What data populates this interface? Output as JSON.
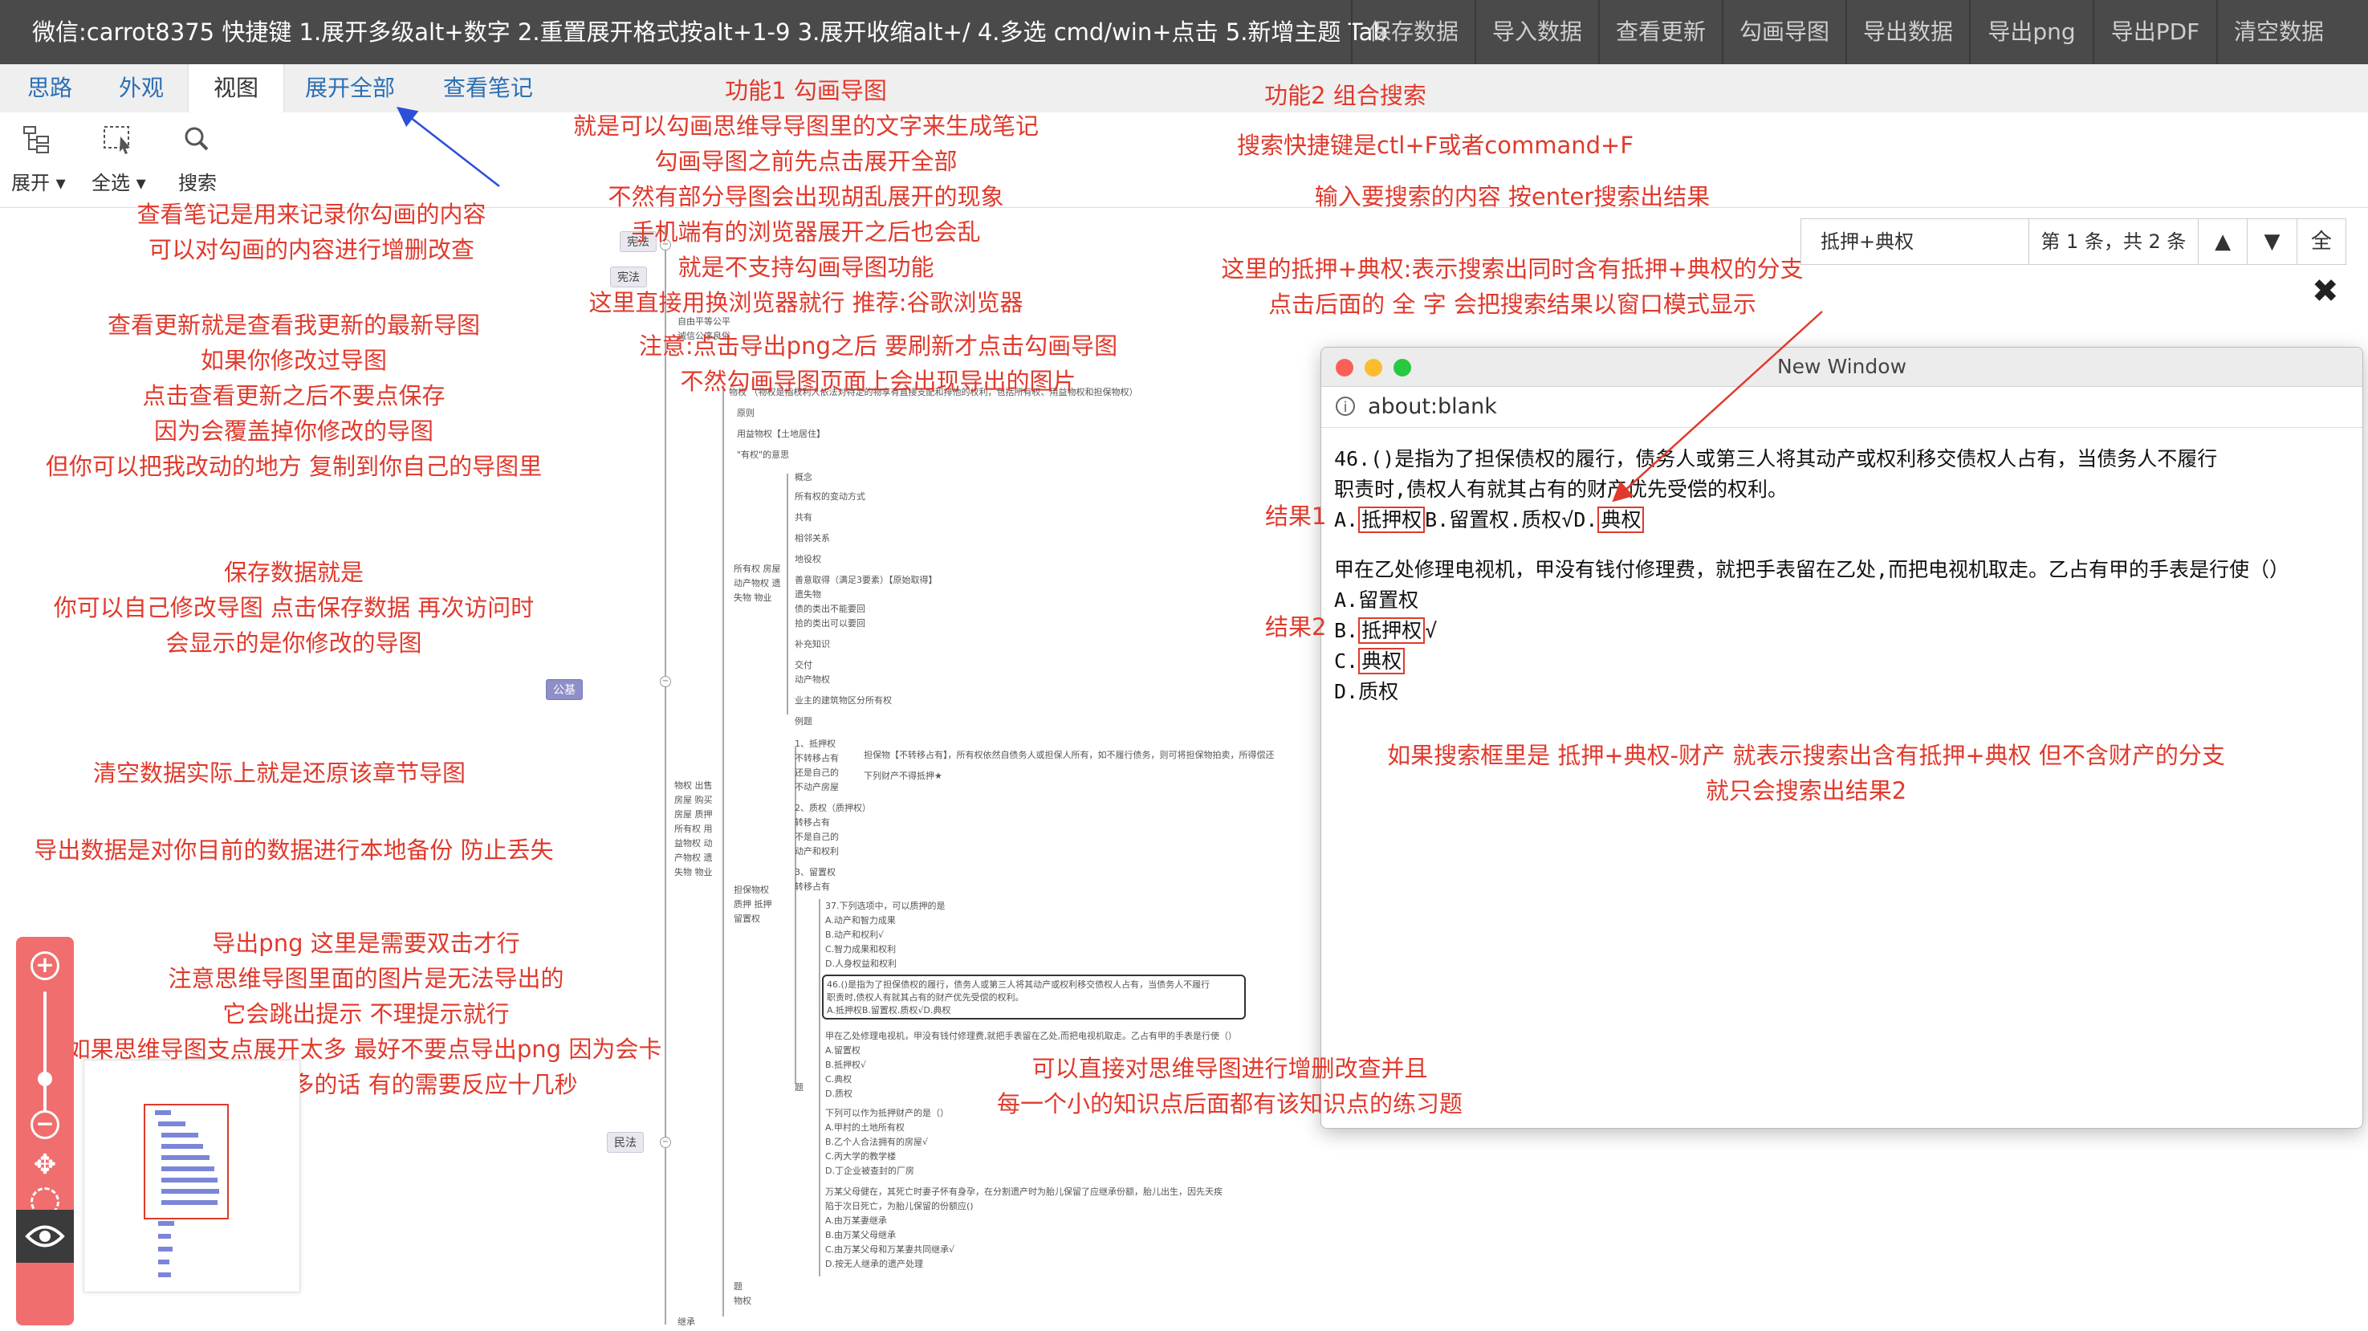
{
  "topbar": {
    "title": "微信:carrot8375 快捷键 1.展开多级alt+数字 2.重置展开格式按alt+1-9 3.展开收缩alt+/ 4.多选 cmd/win+点击 5.新增主题 Tab",
    "buttons": [
      "保存数据",
      "导入数据",
      "查看更新",
      "勾画导图",
      "导出数据",
      "导出png",
      "导出PDF",
      "清空数据"
    ]
  },
  "tabs": [
    "思路",
    "外观",
    "视图",
    "展开全部",
    "查看笔记"
  ],
  "toolbar": {
    "expand": "展开",
    "select_all": "全选",
    "search": "搜索"
  },
  "annotations": {
    "left": [
      "查看笔记是用来记录你勾画的内容",
      "可以对勾画的内容进行增删改查",
      "查看更新就是查看我更新的最新导图",
      "如果你修改过导图",
      "点击查看更新之后不要点保存",
      "因为会覆盖掉你修改的导图",
      "但你可以把我改动的地方 复制到你自己的导图里",
      "保存数据就是",
      "你可以自己修改导图 点击保存数据 再次访问时",
      "会显示的是你修改的导图",
      "清空数据实际上就是还原该章节导图",
      "导出数据是对你目前的数据进行本地备份 防止丢失",
      "导出png 这里是需要双击才行",
      "注意思维导图里面的图片是无法导出的",
      "它会跳出提示 不理提示就行",
      "如果思维导图支点展开太多 最好不要点导出png 因为会卡",
      "如果展开内容多的话 有的需要反应十几秒"
    ],
    "func1": [
      "功能1 勾画导图",
      "就是可以勾画思维导导图里的文字来生成笔记",
      "勾画导图之前先点击展开全部",
      "不然有部分导图会出现胡乱展开的现象",
      "手机端有的浏览器展开之后也会乱",
      "就是不支持勾画导图功能",
      "这里直接用换浏览器就行 推荐:谷歌浏览器",
      "注意:点击导出png之后 要刷新才点击勾画导图",
      "不然勾画导图页面上会出现导出的图片"
    ],
    "func2": [
      "功能2 组合搜索",
      "搜索快捷键是ctl+F或者command+F",
      "输入要搜索的内容 按enter搜索出结果",
      "这里的抵押+典权:表示搜索出同时含有抵押+典权的分支",
      "点击后面的 全 字 会把搜索结果以窗口模式显示"
    ],
    "result1": "结果1",
    "result2": "结果2",
    "exclude": [
      "如果搜索框里是 抵押+典权-财产  就表示搜索出含有抵押+典权 但不含财产的分支",
      "就只会搜索出结果2"
    ],
    "bottom": [
      "可以直接对思维导图进行增删改查并且",
      "每一个小的知识点后面都有该知识点的练习题"
    ]
  },
  "search": {
    "value": "抵押+典权",
    "count": "第 1 条，共 2 条",
    "up": "▲",
    "down": "▼",
    "all": "全"
  },
  "popup": {
    "title": "New Window",
    "url": "about:blank",
    "q1_line1": "46.()是指为了担保债权的履行，债务人或第三人将其动产或权利移交债权人占有，当债务人不履行",
    "q1_line2": "职责时,债权人有就其占有的财产优先受偿的权利。",
    "q1_prefix": "A.",
    "q1_opt_a": "抵押权",
    "q1_mid": "B.留置权.质权√D.",
    "q1_opt_d": "典权",
    "q2_stem": "甲在乙处修理电视机，甲没有钱付修理费，就把手表留在乙处,而把电视机取走。乙占有甲的手表是行使（）",
    "q2_a": "A.留置权",
    "q2_b_prefix": "B.",
    "q2_b": "抵押权",
    "q2_b_suffix": "√",
    "q2_c_prefix": "C.",
    "q2_c": "典权",
    "q2_d": "D.质权"
  },
  "mindmap": {
    "tags": [
      "宪法",
      "宪法",
      "公基",
      "民法"
    ],
    "nodes": [
      "自由平等公平",
      "诚信公序良俗",
      "物权 （物权是指权利人依法对特定的物享有直接支配和排他的权利，包括所有权、用益物权和担保物权）",
      "原则",
      "用益物权【土地居住】",
      "\"有权\"的意思",
      "概念",
      "所有权的变动方式",
      "共有",
      "相邻关系",
      "地役权",
      "善意取得（满足3要素）【原始取得】",
      "遗失物",
      "债的类出不能要回",
      "拾的类出可以要回",
      "补充知识",
      "交付",
      "动产物权",
      "业主的建筑物区分所有权",
      "例题",
      "所有权 房屋 动产物权 遗失物 物业",
      "1、抵押权",
      "不转移占有",
      "还是自己的",
      "不动产房屋",
      "担保物【不转移占有】，所有权依然自债务人或担保人所有，如不履行债务，则可将担保物拍卖，所得偿还",
      "下列财产不得抵押★",
      "2、质权（质押权）",
      "转移占有",
      "不是自己的",
      "动产和权利",
      "3、留置权",
      "转移占有",
      "物权 出售房屋 购买房屋 质押 所有权 用益物权 动产物权 遗失物 物业",
      "担保物权 质押 抵押 留置权",
      "37.下列选项中，可以质押的是",
      "A.动产和智力成果",
      "B.动产和权利√",
      "C.智力成果和权利",
      "D.人身权益和权利",
      "46.()是指为了担保债权的履行，债务人或第三人将其动产或权利移交债权人占有，当债务人不履行",
      "职责时,债权人有就其占有的财产优先受偿的权利。",
      "A.抵押权B.留置权.质权√D.典权",
      "甲在乙处修理电视机，甲没有钱付修理费,就把手表留在乙处,而把电视机取走。乙占有甲的手表是行使（）",
      "A.留置权",
      "B.抵押权√",
      "C.典权",
      "D.质权",
      "题",
      "下列可以作为抵押财产的是（）",
      "A.甲村的土地所有权",
      "B.乙个人合法拥有的房屋√",
      "C.丙大学的教学楼",
      "D.丁企业被查封的厂房",
      "万某父母健在，其死亡时妻子怀有身孕，在分割遗产时为胎儿保留了应继承份额，胎儿出生，因先天疾",
      "陷于次日死亡，为胎儿保留的份额应()",
      "A.由万某妻继承",
      "B.由万某父母继承",
      "C.由万某父母和万某妻共同继承√",
      "D.按无人继承的遗产处理",
      "题",
      "物权",
      "继承"
    ]
  },
  "colors": {
    "accent": "#e03a2c",
    "tab_link": "#2c6fb4",
    "topbar": "#4a4a4a",
    "zoom_bg": "#f06e6e"
  },
  "icons": [
    "expand-icon",
    "select-all-icon",
    "search-icon",
    "zoom-in-icon",
    "zoom-out-icon",
    "move-icon",
    "fit-icon",
    "eye-icon",
    "close-icon",
    "info-icon"
  ]
}
